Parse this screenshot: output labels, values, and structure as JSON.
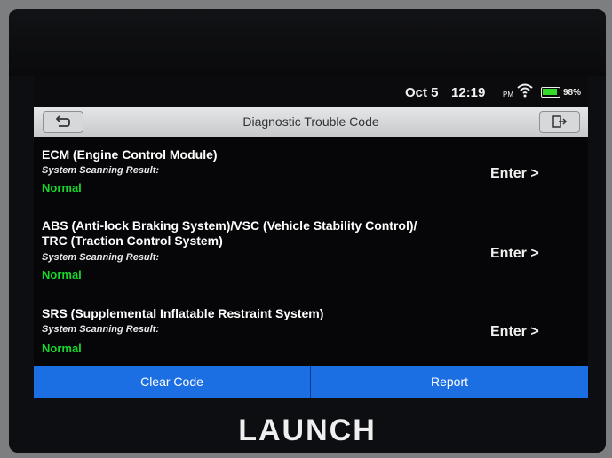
{
  "status": {
    "date": "Oct 5",
    "time": "12:19",
    "ampm": "PM",
    "battery": "98%"
  },
  "header": {
    "title": "Diagnostic Trouble Code"
  },
  "modules": [
    {
      "name_line1": "ECM (Engine Control Module)",
      "name_line2": "",
      "sub": "System Scanning Result:",
      "result": "Normal",
      "enter": "Enter >"
    },
    {
      "name_line1": "ABS (Anti-lock Braking System)/VSC (Vehicle Stability Control)/",
      "name_line2": "TRC (Traction Control System)",
      "sub": "System Scanning Result:",
      "result": "Normal",
      "enter": "Enter >"
    },
    {
      "name_line1": "SRS (Supplemental Inflatable Restraint System)",
      "name_line2": "",
      "sub": "System Scanning Result:",
      "result": "Normal",
      "enter": "Enter >"
    }
  ],
  "actions": {
    "clear": "Clear Code",
    "report": "Report"
  },
  "brand": {
    "logo": "LAUNCH"
  },
  "colors": {
    "accent": "#1c6fe3",
    "normal": "#18d42b"
  }
}
